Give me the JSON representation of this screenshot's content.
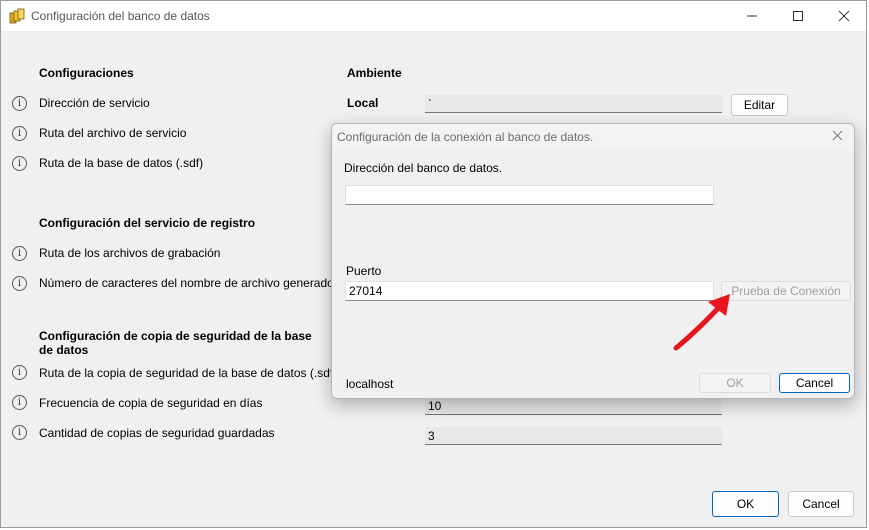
{
  "window": {
    "title": "Configuración del banco de datos",
    "controls": {
      "minimize_icon": "minimize-icon",
      "maximize_icon": "maximize-icon",
      "close_icon": "close-icon"
    }
  },
  "sections": {
    "configuraciones": "Configuraciones",
    "ambiente": "Ambiente",
    "ambiente_value": "Local",
    "registro": "Configuración del servicio de registro",
    "backup": "Configuración de copia de seguridad de la base de datos"
  },
  "rows": {
    "direccion_servicio": "Dirección de servicio",
    "ruta_archivo_servicio": "Ruta del archivo de servicio",
    "ruta_bd": "Ruta de la base de datos (.sdf)",
    "ruta_grabacion": "Ruta de los archivos de grabación",
    "num_caracteres": "Número de caracteres del nombre de archivo generado",
    "ruta_copia": "Ruta de la copia de seguridad de la base de datos (.sdf)",
    "frecuencia": "Frecuencia de copia de seguridad en días",
    "cantidad": "Cantidad de copias de seguridad guardadas"
  },
  "values": {
    "direccion_servicio": "`",
    "frecuencia": "10",
    "cantidad": "3"
  },
  "buttons": {
    "editar": "Editar",
    "ok": "OK",
    "cancel": "Cancel"
  },
  "dialog": {
    "title": "Configuración de la conexión al banco de datos.",
    "address_label": "Dirección del banco de datos.",
    "address_value": "",
    "port_label": "Puerto",
    "port_value": "27014",
    "test_button": "Prueba de Conexión",
    "host_text": "localhost",
    "ok": "OK",
    "cancel": "Cancel"
  },
  "colors": {
    "annotation_arrow": "#e8141e",
    "accent": "#0067c0"
  }
}
